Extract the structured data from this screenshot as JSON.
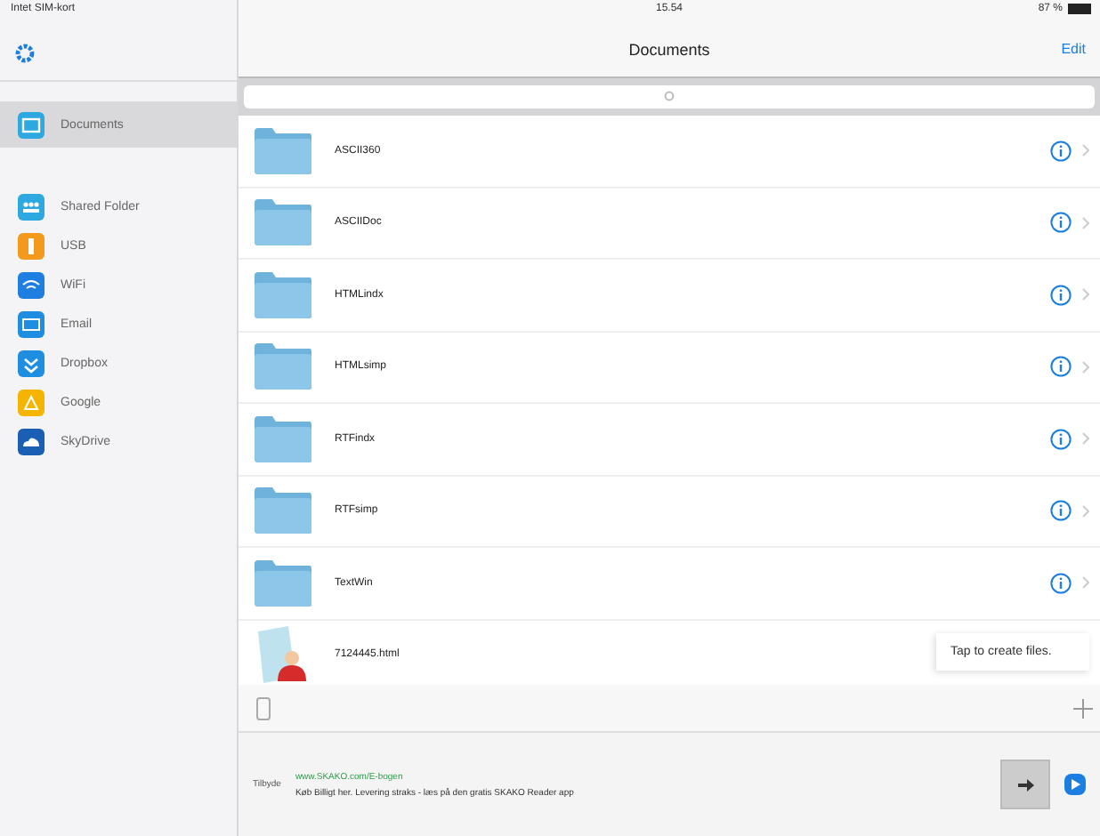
{
  "status_bar": {
    "carrier": "Intet SIM-kort",
    "time": "15.54",
    "battery": "87 %"
  },
  "sidebar": {
    "items": [
      {
        "label": "Documents",
        "kind": "folder",
        "color": "#2ea8e0",
        "selected": true
      },
      {
        "label": "Shared Folder",
        "kind": "shared",
        "color": "#2ea8e0",
        "selected": false
      },
      {
        "label": "USB",
        "kind": "usb",
        "color": "#f39a1e",
        "selected": false
      },
      {
        "label": "WiFi",
        "kind": "wifi",
        "color": "#1f7fe0",
        "selected": false
      },
      {
        "label": "Email",
        "kind": "mail",
        "color": "#1f8ee0",
        "selected": false
      },
      {
        "label": "Dropbox",
        "kind": "box",
        "color": "#1f8ee0",
        "selected": false
      },
      {
        "label": "Google",
        "kind": "drive",
        "color": "#f4b400",
        "selected": false
      },
      {
        "label": "SkyDrive",
        "kind": "cloud",
        "color": "#1a5fb4",
        "selected": false
      }
    ]
  },
  "nav": {
    "title": "Documents",
    "edit": "Edit"
  },
  "files": [
    {
      "name": "ASCII360",
      "kind": "folder"
    },
    {
      "name": "ASCIIDoc",
      "kind": "folder"
    },
    {
      "name": "HTMLindx",
      "kind": "folder"
    },
    {
      "name": "HTMLsimp",
      "kind": "folder"
    },
    {
      "name": "RTFindx",
      "kind": "folder"
    },
    {
      "name": "RTFsimp",
      "kind": "folder"
    },
    {
      "name": "TextWin",
      "kind": "folder"
    },
    {
      "name": "7124445.html",
      "kind": "file"
    }
  ],
  "popover": "Tap to create files.",
  "ad": {
    "label": "Tilbyde",
    "url": "www.SKAKO.com/E-bogen",
    "text": "Køb Billigt her. Levering straks - læs på den gratis SKAKO Reader app"
  }
}
